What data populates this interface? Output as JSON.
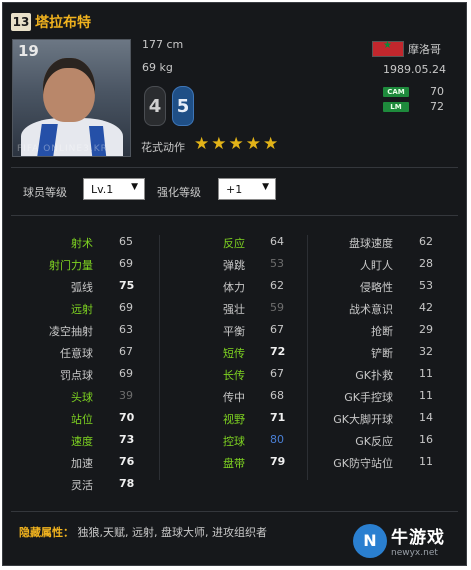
{
  "player": {
    "season_badge": "13",
    "name": "塔拉布特",
    "photo_number": "19",
    "photo_watermark": "FIFA ONLINE3.KR",
    "height": "177 cm",
    "weight": "69 kg",
    "left_foot": "4",
    "right_foot": "5",
    "skill_moves_label": "花式动作",
    "skill_stars": 5,
    "nation": "摩洛哥",
    "birth_date": "1989.05.24",
    "positions": [
      {
        "pos": "CAM",
        "rating": "70"
      },
      {
        "pos": "LM",
        "rating": "72"
      }
    ],
    "colors": {
      "accent": "#f0b21e",
      "highlight": "#7ed321",
      "flag": "#c1272d"
    }
  },
  "controls": {
    "level_label": "球员等级",
    "level_value": "Lv.1",
    "enhance_label": "强化等级",
    "enhance_value": "+1"
  },
  "stats": {
    "col1": [
      {
        "name": "射术",
        "value": "65",
        "hl": true
      },
      {
        "name": "射门力量",
        "value": "69",
        "hl": true
      },
      {
        "name": "弧线",
        "value": "75",
        "hl": false,
        "val": "bold"
      },
      {
        "name": "远射",
        "value": "69",
        "hl": true
      },
      {
        "name": "凌空抽射",
        "value": "63",
        "hl": false
      },
      {
        "name": "任意球",
        "value": "67",
        "hl": false
      },
      {
        "name": "罚点球",
        "value": "69",
        "hl": false
      },
      {
        "name": "头球",
        "value": "39",
        "hl": true,
        "val": "dim"
      },
      {
        "name": "站位",
        "value": "70",
        "hl": true,
        "val": "bold"
      },
      {
        "name": "速度",
        "value": "73",
        "hl": true,
        "val": "bold"
      },
      {
        "name": "加速",
        "value": "76",
        "hl": false,
        "val": "bold"
      },
      {
        "name": "灵活",
        "value": "78",
        "hl": false,
        "val": "bold"
      }
    ],
    "col2": [
      {
        "name": "反应",
        "value": "64",
        "hl": true
      },
      {
        "name": "弹跳",
        "value": "53",
        "hl": false,
        "val": "dim"
      },
      {
        "name": "体力",
        "value": "62",
        "hl": false
      },
      {
        "name": "强壮",
        "value": "59",
        "hl": false,
        "val": "dim"
      },
      {
        "name": "平衡",
        "value": "67",
        "hl": false
      },
      {
        "name": "短传",
        "value": "72",
        "hl": true,
        "val": "bold"
      },
      {
        "name": "长传",
        "value": "67",
        "hl": true
      },
      {
        "name": "传中",
        "value": "68",
        "hl": false
      },
      {
        "name": "视野",
        "value": "71",
        "hl": true,
        "val": "bold"
      },
      {
        "name": "控球",
        "value": "80",
        "hl": true,
        "val": "blue"
      },
      {
        "name": "盘带",
        "value": "79",
        "hl": true,
        "val": "bold"
      }
    ],
    "col3": [
      {
        "name": "盘球速度",
        "value": "62",
        "hl": false
      },
      {
        "name": "人盯人",
        "value": "28",
        "hl": false
      },
      {
        "name": "侵略性",
        "value": "53",
        "hl": false
      },
      {
        "name": "战术意识",
        "value": "42",
        "hl": false
      },
      {
        "name": "抢断",
        "value": "29",
        "hl": false
      },
      {
        "name": "铲断",
        "value": "32",
        "hl": false
      },
      {
        "name": "GK扑救",
        "value": "11",
        "hl": false
      },
      {
        "name": "GK手控球",
        "value": "11",
        "hl": false
      },
      {
        "name": "GK大脚开球",
        "value": "14",
        "hl": false
      },
      {
        "name": "GK反应",
        "value": "16",
        "hl": false
      },
      {
        "name": "GK防守站位",
        "value": "11",
        "hl": false
      }
    ]
  },
  "hidden_attributes": {
    "label": "隐藏属性：",
    "value": "独狼,天赋, 远射, 盘球大师, 进攻组织者"
  },
  "watermark": {
    "logo_char": "N",
    "site_cn": "牛游戏",
    "site_url": "newyx.net"
  }
}
